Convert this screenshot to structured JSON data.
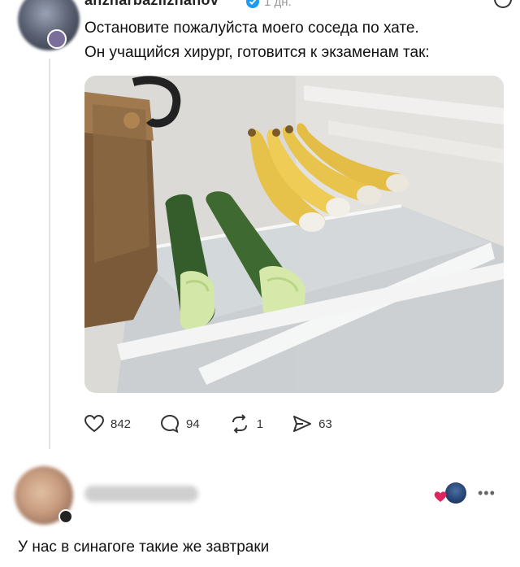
{
  "post": {
    "username": "anzharbazilzhanov",
    "time": "1 дн.",
    "text_lines": [
      "Остановите пожалуйста моего соседа по хате.",
      "Он учащийся хирург, готовится к экзаменам так:"
    ],
    "photo_icon": "fridge-photo"
  },
  "actions": {
    "likes": "842",
    "comments": "94",
    "reposts": "1",
    "shares": "63"
  },
  "reply": {
    "text": "У нас в синагоге такие же завтраки"
  },
  "colors": {
    "verified": "#1d9bf0",
    "heart": "#e0245e",
    "cucumber": "#3e6a32",
    "banana": "#e7c24a"
  }
}
